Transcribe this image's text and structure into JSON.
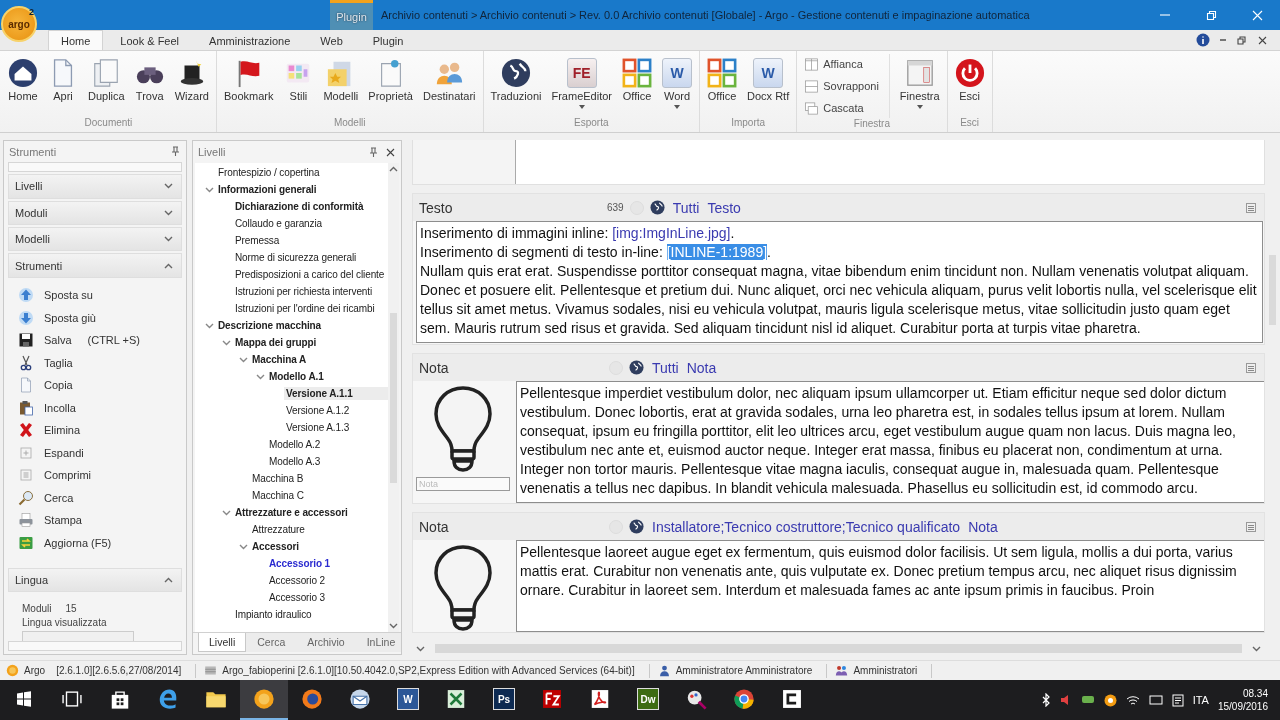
{
  "window": {
    "title": "Archivio contenuti > Archivio contenuti > Rev. 0.0 Archivio contenuti [Globale] - Argo - Gestione contenuti e impaginazione automatica",
    "context_tab": "Plugin"
  },
  "logo": {
    "text": "argo",
    "mark": "2"
  },
  "ribbon_tabs": [
    {
      "label": "Home",
      "selected": true
    },
    {
      "label": "Look & Feel",
      "selected": false
    },
    {
      "label": "Amministrazione",
      "selected": false
    },
    {
      "label": "Web",
      "selected": false
    },
    {
      "label": "Plugin",
      "selected": false
    }
  ],
  "ribbon_groups": [
    {
      "label": "Documenti",
      "buttons": [
        {
          "label": "Home",
          "kind": "house",
          "dropdown": false
        },
        {
          "label": "Apri",
          "kind": "page",
          "dropdown": false
        },
        {
          "label": "Duplica",
          "kind": "pages",
          "dropdown": false
        },
        {
          "label": "Trova",
          "kind": "binoculars",
          "dropdown": false
        },
        {
          "label": "Wizard",
          "kind": "hat",
          "dropdown": false
        }
      ]
    },
    {
      "label": "Modelli",
      "buttons": [
        {
          "label": "Bookmark",
          "kind": "flag",
          "dropdown": false
        },
        {
          "label": "Stili",
          "kind": "palette",
          "dropdown": false
        },
        {
          "label": "Modelli",
          "kind": "folder",
          "dropdown": false
        },
        {
          "label": "Proprietà",
          "kind": "note",
          "dropdown": false
        },
        {
          "label": "Destinatari",
          "kind": "people",
          "dropdown": false
        }
      ]
    },
    {
      "label": "Esporta",
      "buttons": [
        {
          "label": "Traduzioni",
          "kind": "globe",
          "dropdown": false
        },
        {
          "label": "FrameEditor",
          "kind": "fe",
          "glyph": "FE",
          "dropdown": true
        },
        {
          "label": "Office",
          "kind": "office",
          "dropdown": false
        },
        {
          "label": "Word",
          "kind": "word",
          "glyph": "W",
          "dropdown": true
        }
      ]
    },
    {
      "label": "Importa",
      "buttons": [
        {
          "label": "Office",
          "kind": "office",
          "dropdown": false
        },
        {
          "label": "Docx Rtf",
          "kind": "word",
          "glyph": "W",
          "dropdown": false
        }
      ]
    },
    {
      "label": "Finestra",
      "small_buttons": [
        {
          "label": "Affianca",
          "kind": "tile-v"
        },
        {
          "label": "Sovrapponi",
          "kind": "tile-h"
        },
        {
          "label": "Cascata",
          "kind": "cascade"
        }
      ],
      "buttons": [
        {
          "label": "Finestra",
          "kind": "window",
          "dropdown": true
        }
      ]
    },
    {
      "label": "Esci",
      "buttons": [
        {
          "label": "Esci",
          "kind": "power",
          "dropdown": false
        }
      ]
    }
  ],
  "tools_panel": {
    "title": "Strumenti",
    "sections": [
      {
        "label": "Livelli",
        "expanded": false
      },
      {
        "label": "Moduli",
        "expanded": false
      },
      {
        "label": "Modelli",
        "expanded": false
      },
      {
        "label": "Strumenti",
        "expanded": true,
        "items": [
          {
            "label": "Sposta su",
            "kind": "arrow-up"
          },
          {
            "label": "Sposta giù",
            "kind": "arrow-down"
          },
          {
            "label": "Salva",
            "shortcut": "(CTRL +S)",
            "kind": "disk"
          },
          {
            "label": "Taglia",
            "kind": "scissors"
          },
          {
            "label": "Copia",
            "kind": "page"
          },
          {
            "label": "Incolla",
            "kind": "clipboard"
          },
          {
            "label": "Elimina",
            "kind": "cross"
          },
          {
            "label": "Espandi",
            "kind": "plus-box"
          },
          {
            "label": "Comprimi",
            "kind": "minus-box"
          },
          {
            "label": "Cerca",
            "kind": "magnifier"
          },
          {
            "label": "Stampa",
            "kind": "printer"
          },
          {
            "label": "Aggiorna (F5)",
            "kind": "refresh"
          }
        ]
      },
      {
        "label": "Lingua",
        "expanded": true,
        "fields": [
          {
            "label": "Moduli",
            "value": "15"
          },
          {
            "label": "Lingua visualizzata"
          }
        ]
      }
    ]
  },
  "tree_panel": {
    "title": "Livelli",
    "nodes": [
      {
        "label": "Frontespizio / copertina",
        "bold": false,
        "selected": false,
        "current": false
      },
      {
        "label": "Informazioni generali",
        "bold": true,
        "selected": false,
        "current": false,
        "expanded": true,
        "children": [
          {
            "label": "Dichiarazione di conformità",
            "bold": true,
            "selected": false,
            "current": false
          },
          {
            "label": "Collaudo e garanzia",
            "bold": false,
            "selected": false,
            "current": false
          },
          {
            "label": "Premessa",
            "bold": false,
            "selected": false,
            "current": false
          },
          {
            "label": "Norme di sicurezza generali",
            "bold": false,
            "selected": false,
            "current": false
          },
          {
            "label": "Predisposizioni a carico del cliente",
            "bold": false,
            "selected": false,
            "current": false
          },
          {
            "label": "Istruzioni per richiesta interventi",
            "bold": false,
            "selected": false,
            "current": false
          },
          {
            "label": "Istruzioni per l'ordine dei ricambi",
            "bold": false,
            "selected": false,
            "current": false
          }
        ]
      },
      {
        "label": "Descrizione macchina",
        "bold": true,
        "selected": false,
        "current": false,
        "expanded": true,
        "children": [
          {
            "label": "Mappa dei gruppi",
            "bold": true,
            "selected": false,
            "current": false,
            "expanded": true,
            "children": [
              {
                "label": "Macchina A",
                "bold": true,
                "selected": false,
                "current": false,
                "expanded": true,
                "children": [
                  {
                    "label": "Modello A.1",
                    "bold": true,
                    "selected": false,
                    "current": false,
                    "expanded": true,
                    "children": [
                      {
                        "label": "Versione A.1.1",
                        "bold": true,
                        "selected": true,
                        "current": false
                      },
                      {
                        "label": "Versione A.1.2",
                        "bold": false,
                        "selected": false,
                        "current": false
                      },
                      {
                        "label": "Versione A.1.3",
                        "bold": false,
                        "selected": false,
                        "current": false
                      }
                    ]
                  },
                  {
                    "label": "Modello A.2",
                    "bold": false,
                    "selected": false,
                    "current": false
                  },
                  {
                    "label": "Modello A.3",
                    "bold": false,
                    "selected": false,
                    "current": false
                  }
                ]
              },
              {
                "label": "Macchina B",
                "bold": false,
                "selected": false,
                "current": false
              },
              {
                "label": "Macchina C",
                "bold": false,
                "selected": false,
                "current": false
              }
            ]
          },
          {
            "label": "Attrezzature e accessori",
            "bold": true,
            "selected": false,
            "current": false,
            "expanded": true,
            "children": [
              {
                "label": "Attrezzature",
                "bold": false,
                "selected": false,
                "current": false
              },
              {
                "label": "Accessori",
                "bold": true,
                "selected": false,
                "current": false,
                "expanded": true,
                "children": [
                  {
                    "label": "Accessorio 1",
                    "bold": true,
                    "selected": false,
                    "current": true
                  },
                  {
                    "label": "Accessorio 2",
                    "bold": false,
                    "selected": false,
                    "current": false
                  },
                  {
                    "label": "Accessorio 3",
                    "bold": false,
                    "selected": false,
                    "current": false
                  }
                ]
              }
            ]
          },
          {
            "label": "Impianto idraulico",
            "bold": false,
            "selected": false,
            "current": false
          }
        ]
      }
    ],
    "tabs": [
      {
        "label": "Livelli",
        "selected": true
      },
      {
        "label": "Cerca",
        "selected": false
      },
      {
        "label": "Archivio",
        "selected": false
      },
      {
        "label": "InLine",
        "selected": false
      }
    ]
  },
  "sections": [
    {
      "title": "Testo",
      "count": "639",
      "kind": "text",
      "links": [
        "Tutti",
        "Testo"
      ],
      "lines": [
        [
          {
            "kind": "plain",
            "text": "Inserimento di immagini inline: "
          },
          {
            "kind": "link",
            "text": "[img:ImgInLine.jpg]"
          },
          {
            "kind": "plain",
            "text": "."
          }
        ],
        [
          {
            "kind": "plain",
            "text": "Inserimento di segmenti di testo in-line: "
          },
          {
            "kind": "selected",
            "text": "[INLINE-1:1989]"
          },
          {
            "kind": "plain",
            "text": "."
          }
        ],
        [
          {
            "kind": "plain",
            "text": " Nullam quis erat erat. Suspendisse porttitor consequat magna, vitae bibendum enim tincidunt non. Nullam venenatis volutpat aliquam. Donec et posuere elit. Pellentesque et pretium dui. Nunc aliquet, orci nec vehicula aliquam, purus velit lobortis nulla, vel scelerisque elit tellus sit amet metus. Vivamus sodales, nisi eu vehicula volutpat, mauris ligula scelerisque metus, vitae sollicitudin justo quam eget sem. Mauris rutrum sed risus et gravida. Sed aliquam tincidunt nisl id aliquet. Curabitur porta at turpis vitae pharetra."
          }
        ]
      ]
    },
    {
      "title": "Nota",
      "kind": "note",
      "links": [
        "Tutti",
        "Nota"
      ],
      "caption_placeholder": "Nota",
      "paragraph": "Pellentesque imperdiet vestibulum dolor, nec aliquam ipsum ullamcorper ut. Etiam efficitur neque sed dolor dictum vestibulum. Donec lobortis, erat at gravida sodales, urna leo pharetra est, in sodales tellus ipsum at lorem. Nullam consequat, ipsum eu fringilla porttitor, elit leo ultrices arcu, eget vestibulum augue quam non lacus. Duis magna leo, vestibulum nec ante et, euismod auctor neque. Integer erat massa, finibus eu placerat non, condimentum at urna. Integer non tortor mauris. Pellentesque vitae magna iaculis, consequat augue in, malesuada quam. Pellentesque venenatis a tellus nec dapibus. In blandit vehicula malesuada. Phasellus eu sollicitudin est, id commodo arcu."
    },
    {
      "title": "Nota",
      "kind": "note",
      "links": [
        "Installatore;Tecnico costruttore;Tecnico qualificato",
        "Nota"
      ],
      "paragraph": "Pellentesque laoreet augue eget ex fermentum, quis euismod dolor facilisis. Ut sem ligula, mollis a dui porta, varius mattis erat. Curabitur non venenatis ante, quis vulputate ex. Donec pretium tempus arcu, nec aliquet risus dignissim ornare. Curabitur in laoreet sem. Interdum et malesuada fames ac ante ipsum primis in faucibus. Proin"
    }
  ],
  "status_bar": [
    {
      "kind": "argo",
      "texts": [
        "Argo",
        "[2.6.1.0][2.6.5.6,27/08/2014]"
      ]
    },
    {
      "kind": "server",
      "texts": [
        "Argo_fabioperini [2.6.1.0][10.50.4042.0,SP2,Express Edition with Advanced Services (64-bit)]"
      ]
    },
    {
      "kind": "user",
      "texts": [
        "Amministratore Amministratore"
      ]
    },
    {
      "kind": "group",
      "texts": [
        "Amministratori"
      ]
    }
  ],
  "taskbar": {
    "apps": [
      {
        "kind": "windows",
        "active": false
      },
      {
        "kind": "taskview",
        "active": false
      },
      {
        "kind": "store",
        "active": false
      },
      {
        "kind": "edge",
        "active": false
      },
      {
        "kind": "folder",
        "active": false
      },
      {
        "kind": "argo",
        "active": true
      },
      {
        "kind": "firefox",
        "active": false
      },
      {
        "kind": "mail",
        "active": false
      },
      {
        "kind": "tile",
        "glyph": "W",
        "color": "#2b5797",
        "active": false
      },
      {
        "kind": "excel",
        "active": false
      },
      {
        "kind": "tile",
        "glyph": "Ps",
        "color": "#0d2a52",
        "active": false
      },
      {
        "kind": "filezilla",
        "active": false
      },
      {
        "kind": "pdf",
        "active": false
      },
      {
        "kind": "tile",
        "glyph": "Dw",
        "color": "#3d6b12",
        "active": false
      },
      {
        "kind": "paint",
        "active": false
      },
      {
        "kind": "chrome",
        "active": false
      },
      {
        "kind": "capp",
        "active": false
      }
    ],
    "tray": {
      "language": "ITA",
      "time": "08.34",
      "date": "15/09/2016"
    }
  }
}
